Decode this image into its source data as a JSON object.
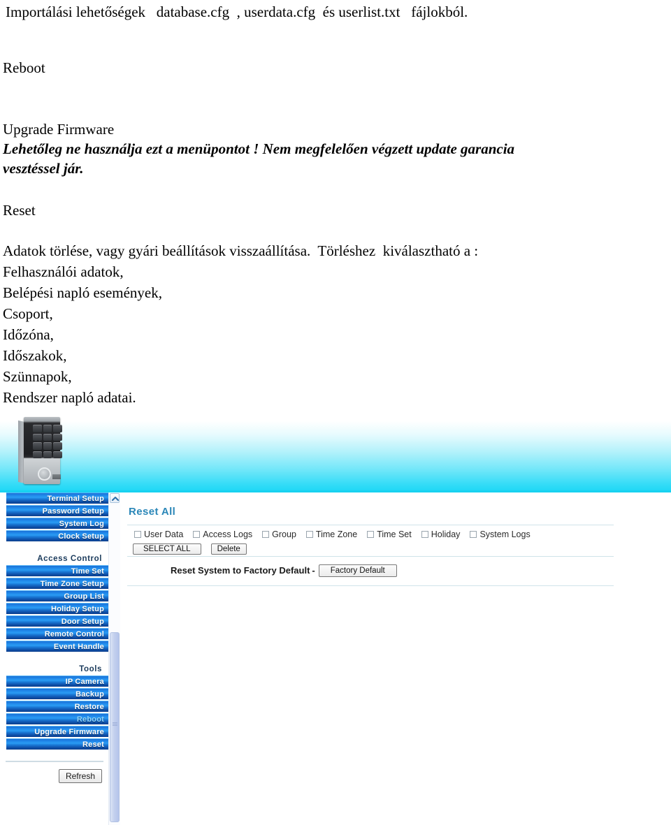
{
  "document": {
    "intro": "Importálási lehetőségek   database.cfg  , userdata.cfg  és userlist.txt   fájlokból.",
    "reboot_heading": "Reboot",
    "upgrade_heading": "Upgrade Firmware",
    "upgrade_warning_line1": "Lehetőleg ne használja ezt a menüpontot ! Nem megfelelően végzett update garancia",
    "upgrade_warning_line2": "vesztéssel jár.",
    "reset_heading": "Reset",
    "reset_description": "Adatok törlése, vagy gyári beállítások visszaállítása.  Törléshez  kiválasztható a :",
    "reset_items": [
      "Felhasználói adatok,",
      "Belépési napló események,",
      "Csoport,",
      "Időzóna,",
      "Időszakok,",
      "Szünnapok,",
      "Rendszer napló adatai."
    ]
  },
  "screenshot": {
    "banner": {
      "device_image_name": "keypad-access-terminal",
      "gradient_top": "#ffffff",
      "gradient_bottom": "#22d8f6"
    },
    "sidebar": {
      "groups": [
        {
          "heading": "",
          "items": [
            {
              "label": "Terminal Setup",
              "state": "normal"
            },
            {
              "label": "Password Setup",
              "state": "normal"
            },
            {
              "label": "System Log",
              "state": "normal"
            },
            {
              "label": "Clock Setup",
              "state": "normal"
            }
          ]
        },
        {
          "heading": "Access Control",
          "items": [
            {
              "label": "Time Set",
              "state": "normal"
            },
            {
              "label": "Time Zone Setup",
              "state": "normal"
            },
            {
              "label": "Group List",
              "state": "normal"
            },
            {
              "label": "Holiday Setup",
              "state": "normal"
            },
            {
              "label": "Door Setup",
              "state": "normal"
            },
            {
              "label": "Remote Control",
              "state": "normal"
            },
            {
              "label": "Event Handle",
              "state": "normal"
            }
          ]
        },
        {
          "heading": "Tools",
          "items": [
            {
              "label": "IP Camera",
              "state": "normal"
            },
            {
              "label": "Backup",
              "state": "normal"
            },
            {
              "label": "Restore",
              "state": "normal"
            },
            {
              "label": "Reboot",
              "state": "dim"
            },
            {
              "label": "Upgrade Firmware",
              "state": "normal"
            },
            {
              "label": "Reset",
              "state": "normal"
            }
          ]
        }
      ],
      "refresh_label": "Refresh",
      "button_color": "#1f86e8"
    },
    "scrollbar": {
      "up_arrow_icon": "chevron-up-icon",
      "orientation": "vertical"
    },
    "content": {
      "title": "Reset All",
      "title_color": "#2b87b8",
      "checkboxes": [
        {
          "label": "User Data",
          "checked": false
        },
        {
          "label": "Access Logs",
          "checked": false
        },
        {
          "label": "Group",
          "checked": false
        },
        {
          "label": "Time Zone",
          "checked": false
        },
        {
          "label": "Time Set",
          "checked": false
        },
        {
          "label": "Holiday",
          "checked": false
        },
        {
          "label": "System Logs",
          "checked": false
        }
      ],
      "select_all_label": "SELECT ALL",
      "delete_label": "Delete",
      "factory_label": "Reset System to Factory Default",
      "factory_dash": "-",
      "factory_button_label": "Factory Default"
    }
  }
}
